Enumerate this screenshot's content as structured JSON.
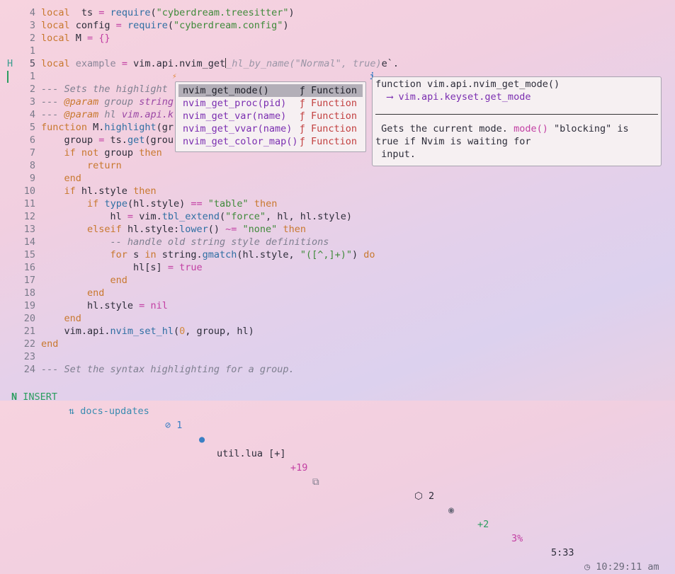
{
  "editor": {
    "lines": [
      {
        "sign": "",
        "num": "4",
        "tokens": [
          [
            "kw",
            "local"
          ],
          [
            "",
            "  ts "
          ],
          [
            "op",
            "="
          ],
          [
            "",
            " "
          ],
          [
            "fn",
            "require"
          ],
          [
            "",
            "("
          ],
          [
            "str",
            "\"cyberdream.treesitter\""
          ],
          [
            "",
            ")"
          ]
        ]
      },
      {
        "sign": "",
        "num": "3",
        "tokens": [
          [
            "kw",
            "local"
          ],
          [
            "",
            ""
          ],
          [
            "",
            " config "
          ],
          [
            "op",
            "="
          ],
          [
            "",
            " "
          ],
          [
            "fn",
            "require"
          ],
          [
            "",
            "("
          ],
          [
            "str",
            "\"cyberdream.config\""
          ],
          [
            "",
            ")"
          ]
        ]
      },
      {
        "sign": "",
        "num": "2",
        "tokens": [
          [
            "kw",
            "local"
          ],
          [
            "",
            " M "
          ],
          [
            "op",
            "="
          ],
          [
            "",
            " "
          ],
          [
            "op",
            "{}"
          ]
        ]
      },
      {
        "sign": "",
        "num": "1",
        "tokens": []
      },
      {
        "sign": "H",
        "num": "5",
        "cur": true,
        "tokens": [
          [
            "kw",
            "local"
          ],
          [
            "",
            " "
          ],
          [
            "ghost2",
            "example"
          ],
          [
            "",
            " "
          ],
          [
            "op",
            "="
          ],
          [
            "",
            " vim.api.nvim_get"
          ],
          [
            "caret",
            ""
          ],
          [
            "ghost",
            "_hl_by_name(\"Normal\", true)"
          ],
          [
            "",
            "e`."
          ]
        ]
      },
      {
        "sign": "",
        "num": "1",
        "tokens": []
      },
      {
        "sign": "",
        "num": "2",
        "tokens": [
          [
            "cm",
            "--- Sets the highlight "
          ]
        ]
      },
      {
        "sign": "",
        "num": "3",
        "tokens": [
          [
            "cm",
            "--- "
          ],
          [
            "cmk",
            "@param"
          ],
          [
            "cm",
            " group "
          ],
          [
            "ty",
            "string"
          ]
        ]
      },
      {
        "sign": "",
        "num": "4",
        "tokens": [
          [
            "cm",
            "--- "
          ],
          [
            "cmk",
            "@param"
          ],
          [
            "cm",
            " hl "
          ],
          [
            "ty",
            "vim.api.k"
          ]
        ]
      },
      {
        "sign": "",
        "num": "5",
        "tokens": [
          [
            "kw",
            "function"
          ],
          [
            "",
            " M."
          ],
          [
            "fn",
            "highlight"
          ],
          [
            "",
            "(gr"
          ]
        ]
      },
      {
        "sign": "",
        "num": "6",
        "tokens": [
          [
            "",
            "    group "
          ],
          [
            "op",
            "="
          ],
          [
            "",
            " ts."
          ],
          [
            "fn",
            "get"
          ],
          [
            "",
            "(grou"
          ]
        ]
      },
      {
        "sign": "",
        "num": "7",
        "tokens": [
          [
            "",
            "    "
          ],
          [
            "kw",
            "if not"
          ],
          [
            "",
            " group "
          ],
          [
            "kw",
            "then"
          ]
        ]
      },
      {
        "sign": "",
        "num": "8",
        "tokens": [
          [
            "",
            "        "
          ],
          [
            "kw",
            "return"
          ]
        ]
      },
      {
        "sign": "",
        "num": "9",
        "tokens": [
          [
            "",
            "    "
          ],
          [
            "kw",
            "end"
          ]
        ]
      },
      {
        "sign": "",
        "num": "10",
        "tokens": [
          [
            "",
            "    "
          ],
          [
            "kw",
            "if"
          ],
          [
            "",
            " hl.style "
          ],
          [
            "kw",
            "then"
          ]
        ]
      },
      {
        "sign": "",
        "num": "11",
        "tokens": [
          [
            "",
            "        "
          ],
          [
            "kw",
            "if"
          ],
          [
            "",
            " "
          ],
          [
            "fn",
            "type"
          ],
          [
            "",
            "(hl.style) "
          ],
          [
            "op",
            "=="
          ],
          [
            "",
            " "
          ],
          [
            "str",
            "\"table\""
          ],
          [
            "",
            " "
          ],
          [
            "kw",
            "then"
          ]
        ]
      },
      {
        "sign": "",
        "num": "12",
        "tokens": [
          [
            "",
            "            hl "
          ],
          [
            "op",
            "="
          ],
          [
            "",
            " vim."
          ],
          [
            "fn",
            "tbl_extend"
          ],
          [
            "",
            "("
          ],
          [
            "str",
            "\"force\""
          ],
          [
            "",
            ", hl, hl.style)"
          ]
        ]
      },
      {
        "sign": "",
        "num": "13",
        "tokens": [
          [
            "",
            "        "
          ],
          [
            "kw",
            "elseif"
          ],
          [
            "",
            " hl.style:"
          ],
          [
            "fn",
            "lower"
          ],
          [
            "",
            "() "
          ],
          [
            "op",
            "~="
          ],
          [
            "",
            " "
          ],
          [
            "str",
            "\"none\""
          ],
          [
            "",
            " "
          ],
          [
            "kw",
            "then"
          ]
        ]
      },
      {
        "sign": "",
        "num": "14",
        "tokens": [
          [
            "",
            "            "
          ],
          [
            "cm",
            "-- handle old string style definitions"
          ]
        ]
      },
      {
        "sign": "",
        "num": "15",
        "tokens": [
          [
            "",
            "            "
          ],
          [
            "kw",
            "for"
          ],
          [
            "",
            " s "
          ],
          [
            "kw",
            "in"
          ],
          [
            "",
            " string."
          ],
          [
            "fn",
            "gmatch"
          ],
          [
            "",
            "(hl.style, "
          ],
          [
            "str",
            "\"([^,]+)\""
          ],
          [
            "",
            ") "
          ],
          [
            "kw",
            "do"
          ]
        ]
      },
      {
        "sign": "",
        "num": "16",
        "tokens": [
          [
            "",
            "                hl[s] "
          ],
          [
            "op",
            "="
          ],
          [
            "",
            " "
          ],
          [
            "op",
            "true"
          ]
        ]
      },
      {
        "sign": "",
        "num": "17",
        "tokens": [
          [
            "",
            "            "
          ],
          [
            "kw",
            "end"
          ]
        ]
      },
      {
        "sign": "",
        "num": "18",
        "tokens": [
          [
            "",
            "        "
          ],
          [
            "kw",
            "end"
          ]
        ]
      },
      {
        "sign": "",
        "num": "19",
        "tokens": [
          [
            "",
            "        hl.style "
          ],
          [
            "op",
            "="
          ],
          [
            "",
            " "
          ],
          [
            "op",
            "nil"
          ]
        ]
      },
      {
        "sign": "",
        "num": "20",
        "tokens": [
          [
            "",
            "    "
          ],
          [
            "kw",
            "end"
          ]
        ]
      },
      {
        "sign": "",
        "num": "21",
        "tokens": [
          [
            "",
            "    vim.api."
          ],
          [
            "fn",
            "nvim_set_hl"
          ],
          [
            "",
            "("
          ],
          [
            "num",
            "0"
          ],
          [
            "",
            ", group, hl)"
          ]
        ]
      },
      {
        "sign": "",
        "num": "22",
        "tokens": [
          [
            "kw",
            "end"
          ]
        ]
      },
      {
        "sign": "",
        "num": "23",
        "tokens": []
      },
      {
        "sign": "",
        "num": "24",
        "tokens": [
          [
            "cm",
            "--- Set the syntax highlighting for a group."
          ]
        ]
      }
    ]
  },
  "completion": {
    "items": [
      {
        "label": "nvim_get_mode()",
        "kind": "ƒ Function",
        "selected": true
      },
      {
        "label": "nvim_get_proc(pid)",
        "kind": "ƒ Function",
        "selected": false
      },
      {
        "label": "nvim_get_var(name)",
        "kind": "ƒ Function",
        "selected": false
      },
      {
        "label": "nvim_get_vvar(name)",
        "kind": "ƒ Function",
        "selected": false
      },
      {
        "label": "nvim_get_color_map()",
        "kind": "ƒ Function",
        "selected": false
      }
    ],
    "marker": "⚡"
  },
  "docs": {
    "marker": "i",
    "signature": "function vim.api.nvim_get_mode()",
    "returns": "  ⟶ vim.api.keyset.get_mode",
    "desc1_a": " Gets the current mode. ",
    "desc1_b": "mode()",
    "desc1_c": " \"blocking\" is",
    "desc2": "true if Nvim is waiting for",
    "desc3": " input."
  },
  "statusbar": {
    "mode": "INSERT",
    "mode_icon": "vim-icon",
    "branch": "docs-updates",
    "diagnostics": "1",
    "file": "util.lua [+]",
    "added": "+19",
    "lsp_count": "2",
    "git_stat": "+2",
    "percent": "3%",
    "position": "5:33",
    "time": "10:29:11 am"
  }
}
